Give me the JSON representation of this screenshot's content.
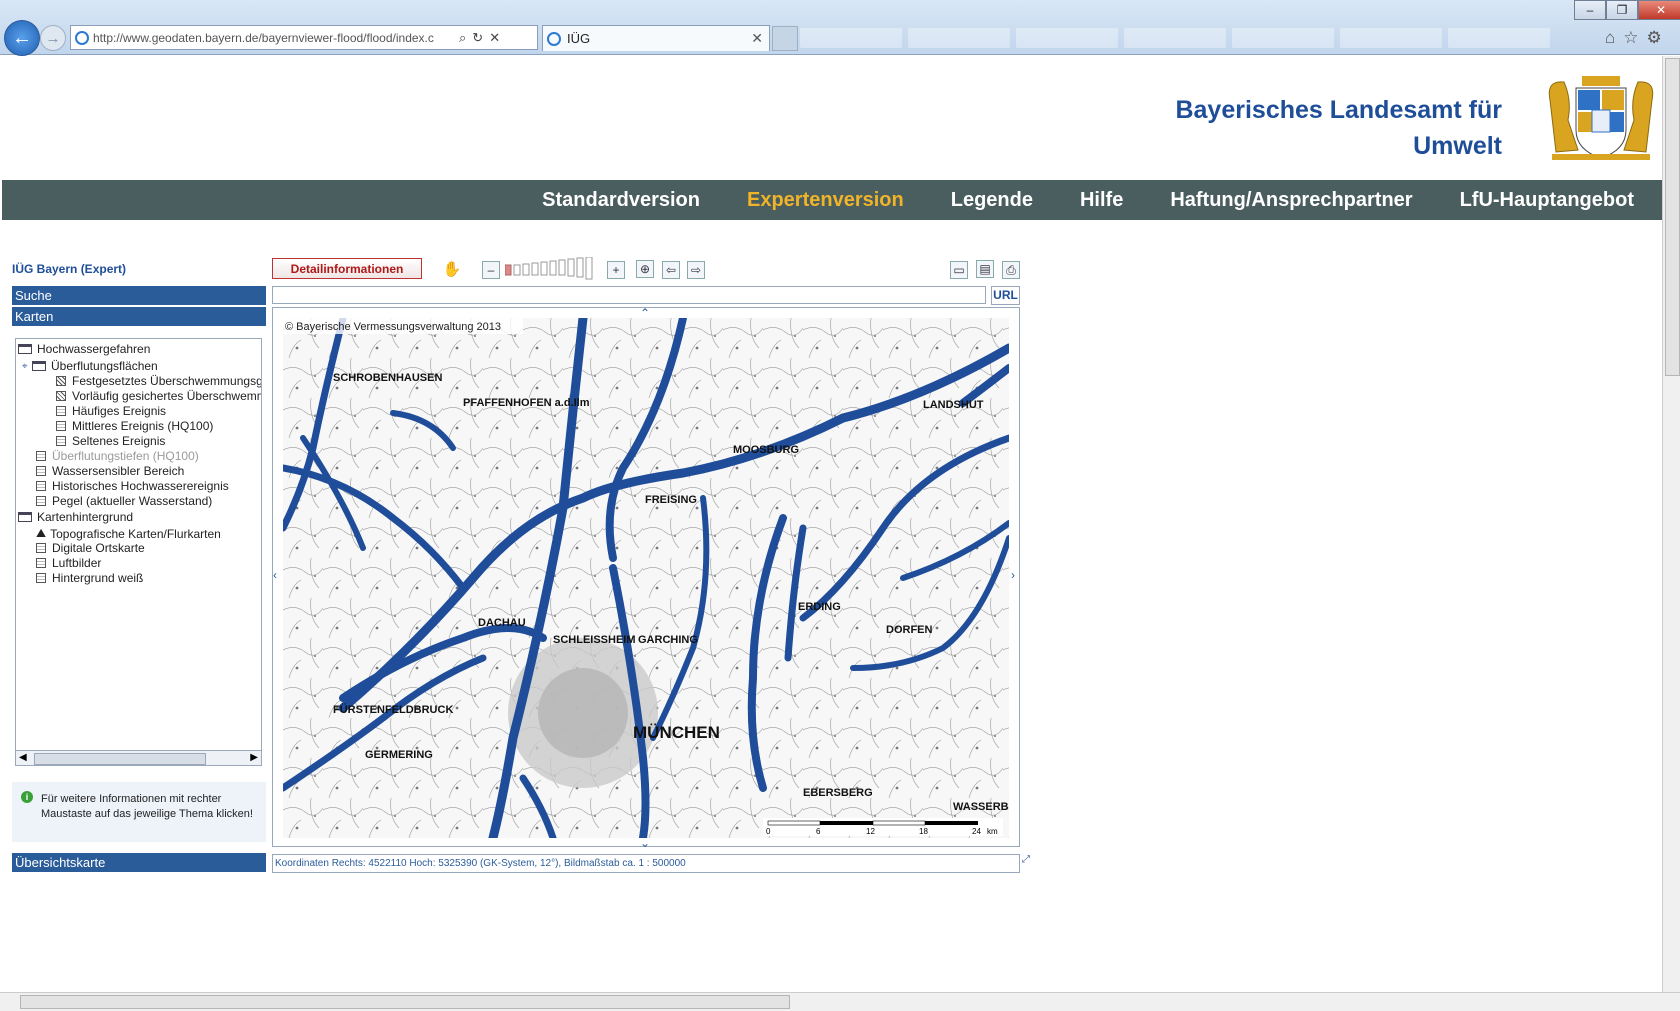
{
  "browser": {
    "url": "http://www.geodaten.bayern.de/bayernviewer-flood/flood/index.c",
    "tab_title": "IÜG",
    "back_glyph": "←",
    "forward_glyph": "→",
    "tab_close_glyph": "✕",
    "window_controls": [
      "–",
      "❐",
      "✕"
    ],
    "toolbar_icons": [
      "⌂",
      "☆",
      "⚙"
    ]
  },
  "header": {
    "title_line1": "Bayerisches Landesamt für",
    "title_line2": "Umwelt"
  },
  "nav": {
    "items": [
      {
        "label": "Standardversion"
      },
      {
        "label": "Expertenversion",
        "active": true
      },
      {
        "label": "Legende"
      },
      {
        "label": "Hilfe"
      },
      {
        "label": "Haftung/Ansprechpartner"
      },
      {
        "label": "LfU-Hauptangebot"
      }
    ],
    "active_color": "#f0b429"
  },
  "left": {
    "app_title": "IÜG Bayern (Expert)",
    "suche": "Suche",
    "karten": "Karten",
    "tree": [
      {
        "label": "Hochwassergefahren"
      },
      {
        "label": "Überflutungsflächen"
      },
      {
        "label": "Festgesetztes Überschwemmungsgebiet"
      },
      {
        "label": "Vorläufig gesichertes Überschwemmungsgebiet"
      },
      {
        "label": "Häufiges Ereignis"
      },
      {
        "label": "Mittleres Ereignis (HQ100)"
      },
      {
        "label": "Seltenes Ereignis"
      },
      {
        "label": "Überflutungstiefen (HQ100)"
      },
      {
        "label": "Wassersensibler Bereich"
      },
      {
        "label": "Historisches Hochwasserereignis"
      },
      {
        "label": "Pegel (aktueller Wasserstand)"
      },
      {
        "label": "Kartenhintergrund"
      },
      {
        "label": "Topografische Karten/Flurkarten"
      },
      {
        "label": "Digitale Ortskarte"
      },
      {
        "label": "Luftbilder"
      },
      {
        "label": "Hintergrund weiß"
      }
    ],
    "info_icon": "i",
    "info_text": "Für weitere Informationen mit rechter Maustaste auf das jeweilige Thema klicken!",
    "uebersicht": "Übersichtskarte"
  },
  "toolbar": {
    "detail_button": "Detailinformationen",
    "zoom_out": "–",
    "zoom_in": "+",
    "url_button": "URL"
  },
  "map": {
    "copyright": "© Bayerische Vermessungsverwaltung 2013",
    "towns": [
      "SCHROBENHAUSEN",
      "PFAFFENHOFEN a.d.Ilm",
      "LANDSHUT",
      "MOOSBURG",
      "FREISING",
      "DACHAU",
      "SCHLEISSHEIM",
      "GARCHING",
      "ERDING",
      "DORFEN",
      "FÜRSTENFELDBRUCK",
      "GERMERING",
      "MÜNCHEN",
      "EBERSBERG",
      "WASSERBURG"
    ],
    "scale_ticks": [
      "0",
      "6",
      "12",
      "18",
      "24"
    ],
    "scale_unit": "km",
    "flood_color": "#1f4d9a",
    "coords_text": "Koordinaten Rechts: 4522110 Hoch: 5325390 (GK-System, 12°), Bildmaßstab ca. 1 : 500000"
  }
}
